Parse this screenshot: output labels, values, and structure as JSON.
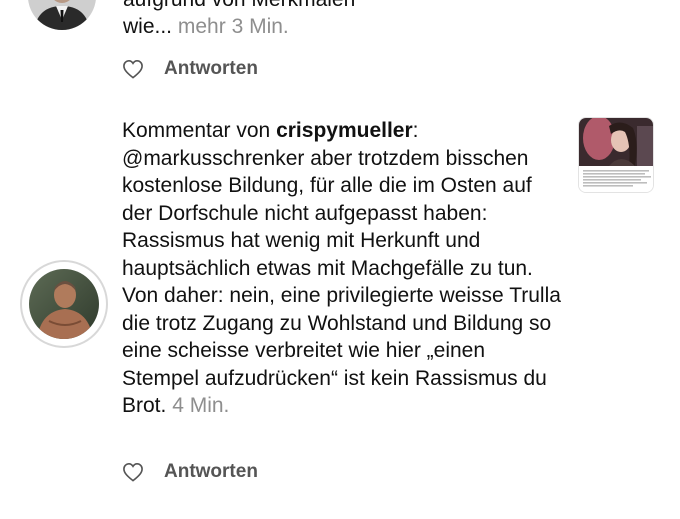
{
  "top_comment": {
    "line1": "aufgrund von Merkmalen",
    "line2": "wie...",
    "more_label": "mehr",
    "time": "3 Min.",
    "reply_label": "Antworten"
  },
  "comment": {
    "prefix": "Kommentar von ",
    "username": "crispymueller",
    "colon": ":",
    "body": "@markusschrenker aber trotzdem bisschen kostenlose Bildung, für alle die im Osten auf der Dorfschule nicht aufgepasst haben: Rassismus hat wenig mit Herkunft und hauptsächlich etwas mit Machgefälle zu tun. Von daher: nein, eine privilegierte weisse Trulla die trotz Zugang zu Wohlstand und Bildung so eine scheisse verbreitet wie hier „einen Stempel aufzudrücken“ ist kein Rassismus du Brot.",
    "time": "4 Min.",
    "reply_label": "Antworten"
  },
  "icons": {
    "like": "heart-outline-icon"
  },
  "colors": {
    "muted": "#8e8e8e",
    "text": "#111111",
    "action": "#555555"
  }
}
